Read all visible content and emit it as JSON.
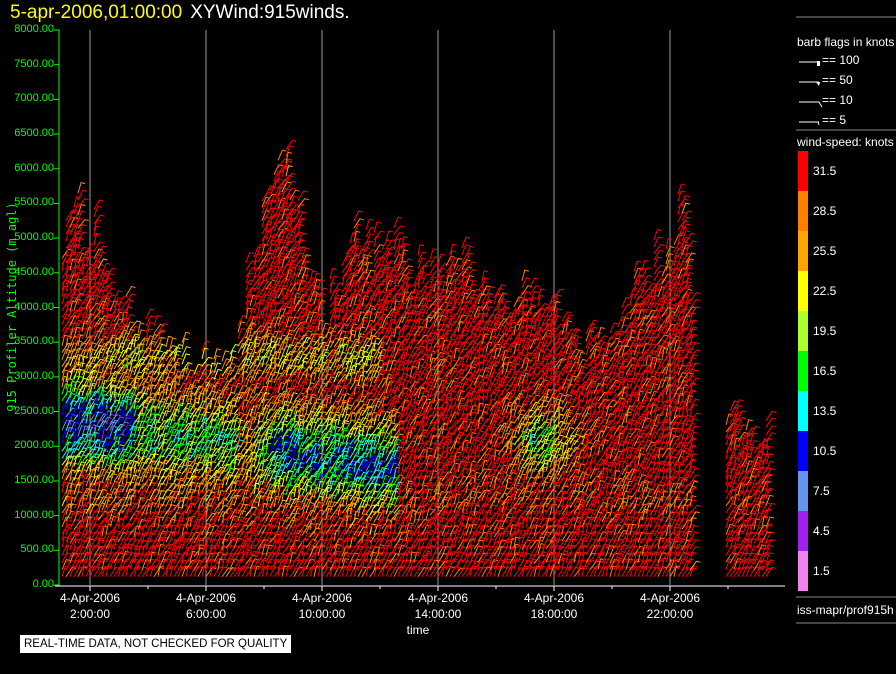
{
  "header": {
    "datetime": "5-apr-2006,01:00:00",
    "name": "XYWind:915winds."
  },
  "notice": "REAL-TIME DATA, NOT CHECKED FOR QUALITY",
  "footer": "iss-mapr/prof915h",
  "chart_data": {
    "type": "wind-barb",
    "ylabel": "915 Profiler Altitude (m agl)",
    "xlabel": "time",
    "ylim": [
      0,
      8000
    ],
    "yticks": [
      "0.00",
      "500.00",
      "1000.00",
      "1500.00",
      "2000.00",
      "2500.00",
      "3000.00",
      "3500.00",
      "4000.00",
      "4500.00",
      "5000.00",
      "5500.00",
      "6000.00",
      "6500.00",
      "7000.00",
      "7500.00",
      "8000.00"
    ],
    "xticks": [
      {
        "date": "4-Apr-2006",
        "time": "2:00:00",
        "hour": 2
      },
      {
        "date": "4-Apr-2006",
        "time": "6:00:00",
        "hour": 6
      },
      {
        "date": "4-Apr-2006",
        "time": "10:00:00",
        "hour": 10
      },
      {
        "date": "4-Apr-2006",
        "time": "14:00:00",
        "hour": 14
      },
      {
        "date": "4-Apr-2006",
        "time": "18:00:00",
        "hour": 18
      },
      {
        "date": "4-Apr-2006",
        "time": "22:00:00",
        "hour": 22
      }
    ],
    "xlim_hours": [
      0.95,
      25.4
    ],
    "grid": "vertical",
    "barb_legend": {
      "title": "barb flags in knots",
      "items": [
        "== 100",
        "== 50",
        "== 10",
        "== 5"
      ]
    },
    "colorbar": {
      "title": "wind-speed: knots",
      "levels": [
        "31.5",
        "28.5",
        "25.5",
        "22.5",
        "19.5",
        "16.5",
        "13.5",
        "10.5",
        "7.5",
        "4.5",
        "1.5"
      ],
      "colors": [
        "#ff0000",
        "#ff8000",
        "#ffa500",
        "#ffff00",
        "#adff2f",
        "#00ff00",
        "#00ffff",
        "#0000ff",
        "#6495ed",
        "#a020f0",
        "#ee82ee"
      ]
    },
    "profile_top_altitude": [
      {
        "hour": 1,
        "alt": 5600
      },
      {
        "hour": 2,
        "alt": 5400
      },
      {
        "hour": 3,
        "alt": 4100
      },
      {
        "hour": 4,
        "alt": 4000
      },
      {
        "hour": 5,
        "alt": 3500
      },
      {
        "hour": 6,
        "alt": 3300
      },
      {
        "hour": 7,
        "alt": 3500
      },
      {
        "hour": 8,
        "alt": 6200
      },
      {
        "hour": 9,
        "alt": 6100
      },
      {
        "hour": 10,
        "alt": 4000
      },
      {
        "hour": 11,
        "alt": 5000
      },
      {
        "hour": 12,
        "alt": 5300
      },
      {
        "hour": 13,
        "alt": 4900
      },
      {
        "hour": 14,
        "alt": 4500
      },
      {
        "hour": 15,
        "alt": 4800
      },
      {
        "hour": 16,
        "alt": 4000
      },
      {
        "hour": 17,
        "alt": 4500
      },
      {
        "hour": 18,
        "alt": 4200
      },
      {
        "hour": 19,
        "alt": 3500
      },
      {
        "hour": 20,
        "alt": 3900
      },
      {
        "hour": 21,
        "alt": 4700
      },
      {
        "hour": 22,
        "alt": 5000
      },
      {
        "hour": 22.5,
        "alt": 6000
      },
      {
        "hour": 23,
        "alt": 1000
      },
      {
        "hour": 24,
        "alt": 2700
      },
      {
        "hour": 24.5,
        "alt": 2300
      }
    ]
  }
}
